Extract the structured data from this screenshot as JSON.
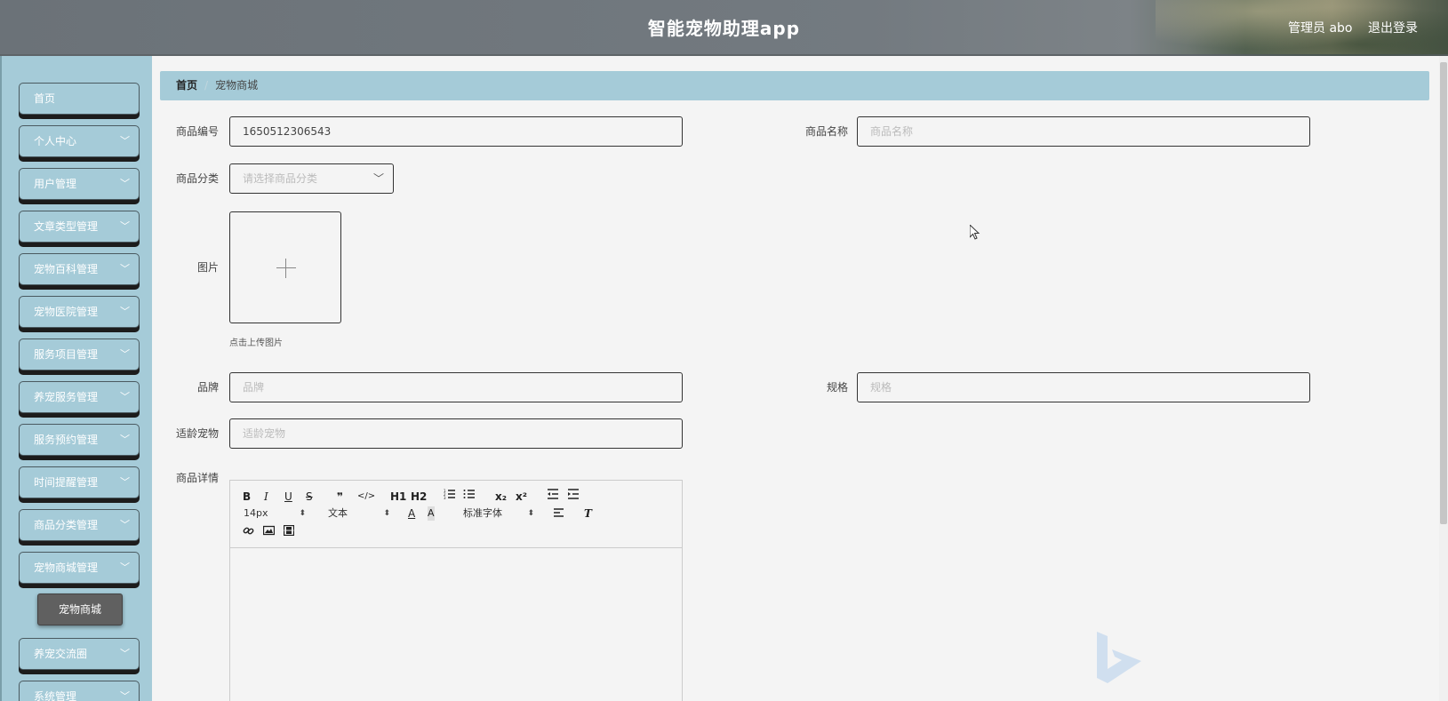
{
  "header": {
    "title": "智能宠物助理app",
    "user_label": "管理员 abo",
    "logout_label": "退出登录"
  },
  "sidebar": {
    "items": [
      {
        "label": "首页",
        "has_children": false
      },
      {
        "label": "个人中心",
        "has_children": true
      },
      {
        "label": "用户管理",
        "has_children": true
      },
      {
        "label": "文章类型管理",
        "has_children": true
      },
      {
        "label": "宠物百科管理",
        "has_children": true
      },
      {
        "label": "宠物医院管理",
        "has_children": true
      },
      {
        "label": "服务项目管理",
        "has_children": true
      },
      {
        "label": "养宠服务管理",
        "has_children": true
      },
      {
        "label": "服务预约管理",
        "has_children": true
      },
      {
        "label": "时间提醒管理",
        "has_children": true
      },
      {
        "label": "商品分类管理",
        "has_children": true
      },
      {
        "label": "宠物商城管理",
        "has_children": true
      },
      {
        "label": "养宠交流圈",
        "has_children": true
      },
      {
        "label": "系统管理",
        "has_children": true
      }
    ],
    "active_submenu": "宠物商城"
  },
  "breadcrumb": {
    "home": "首页",
    "separator": "/",
    "current": "宠物商城"
  },
  "form": {
    "code_label": "商品编号",
    "code_value": "1650512306543",
    "name_label": "商品名称",
    "name_placeholder": "商品名称",
    "category_label": "商品分类",
    "category_placeholder": "请选择商品分类",
    "image_label": "图片",
    "image_hint": "点击上传图片",
    "brand_label": "品牌",
    "brand_placeholder": "品牌",
    "spec_label": "规格",
    "spec_placeholder": "规格",
    "pet_age_label": "适龄宠物",
    "pet_age_placeholder": "适龄宠物",
    "detail_label": "商品详情"
  },
  "editor": {
    "toolbar_row1": [
      "B",
      "I",
      "U",
      "S",
      "❞",
      "</>",
      "H1",
      "H2",
      "ordered-list",
      "bullet-list",
      "x₂",
      "x²",
      "outdent",
      "indent"
    ],
    "font_size": "14px",
    "text_style": "文本",
    "font_family": "标准字体",
    "toolbar_icons": [
      "font-color-icon",
      "background-color-icon",
      "align-icon",
      "clear-format-icon",
      "link-icon",
      "image-icon",
      "video-icon"
    ]
  },
  "colors": {
    "sidebar_bg": "#a5cbd8",
    "active_submenu_bg": "#606060",
    "breadcrumb_bg": "#a5cbd8",
    "page_bg": "#f4f4f4"
  }
}
